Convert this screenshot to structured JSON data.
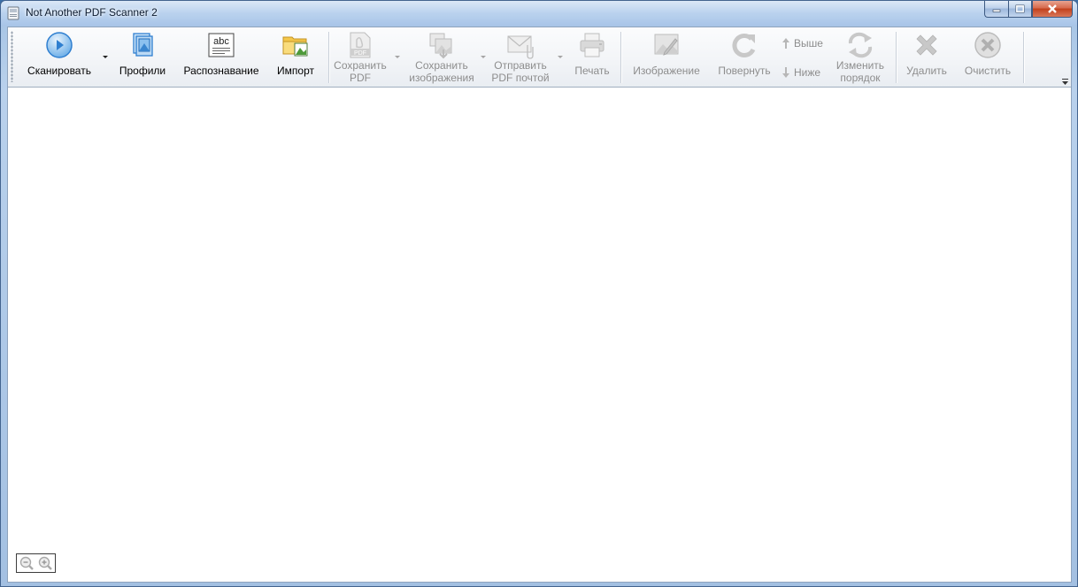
{
  "window": {
    "title": "Not Another PDF Scanner 2"
  },
  "toolbar": {
    "scan": "Сканировать",
    "profiles": "Профили",
    "ocr": "Распознавание",
    "import": "Импорт",
    "save_pdf_line1": "Сохранить",
    "save_pdf_line2": "PDF",
    "save_images_line1": "Сохранить",
    "save_images_line2": "изображения",
    "email_pdf_line1": "Отправить",
    "email_pdf_line2": "PDF почтой",
    "print": "Печать",
    "image": "Изображение",
    "rotate": "Повернуть",
    "move_up": "Выше",
    "move_down": "Ниже",
    "reorder_line1": "Изменить",
    "reorder_line2": "порядок",
    "delete": "Удалить",
    "clear": "Очистить"
  },
  "icons": {
    "app": "scanner-icon",
    "scan": "play-circle-icon",
    "profiles": "profiles-icon",
    "ocr": "abc-document-icon",
    "ocr_text": "abc",
    "import": "folder-image-icon",
    "save_pdf": "pdf-document-icon",
    "save_pdf_text": "PDF",
    "save_images": "images-save-icon",
    "email_pdf": "envelope-icon",
    "print": "printer-icon",
    "image": "image-edit-icon",
    "rotate": "rotate-icon",
    "move_up": "arrow-up-icon",
    "move_down": "arrow-down-icon",
    "reorder": "reorder-arrows-icon",
    "delete": "x-icon",
    "clear": "clear-circle-icon",
    "zoom_out": "zoom-out-icon",
    "zoom_in": "zoom-in-icon"
  },
  "colors": {
    "accent": "#2f7fd0",
    "disabled_text": "#8d8d8d",
    "close_button": "#c2411c"
  }
}
